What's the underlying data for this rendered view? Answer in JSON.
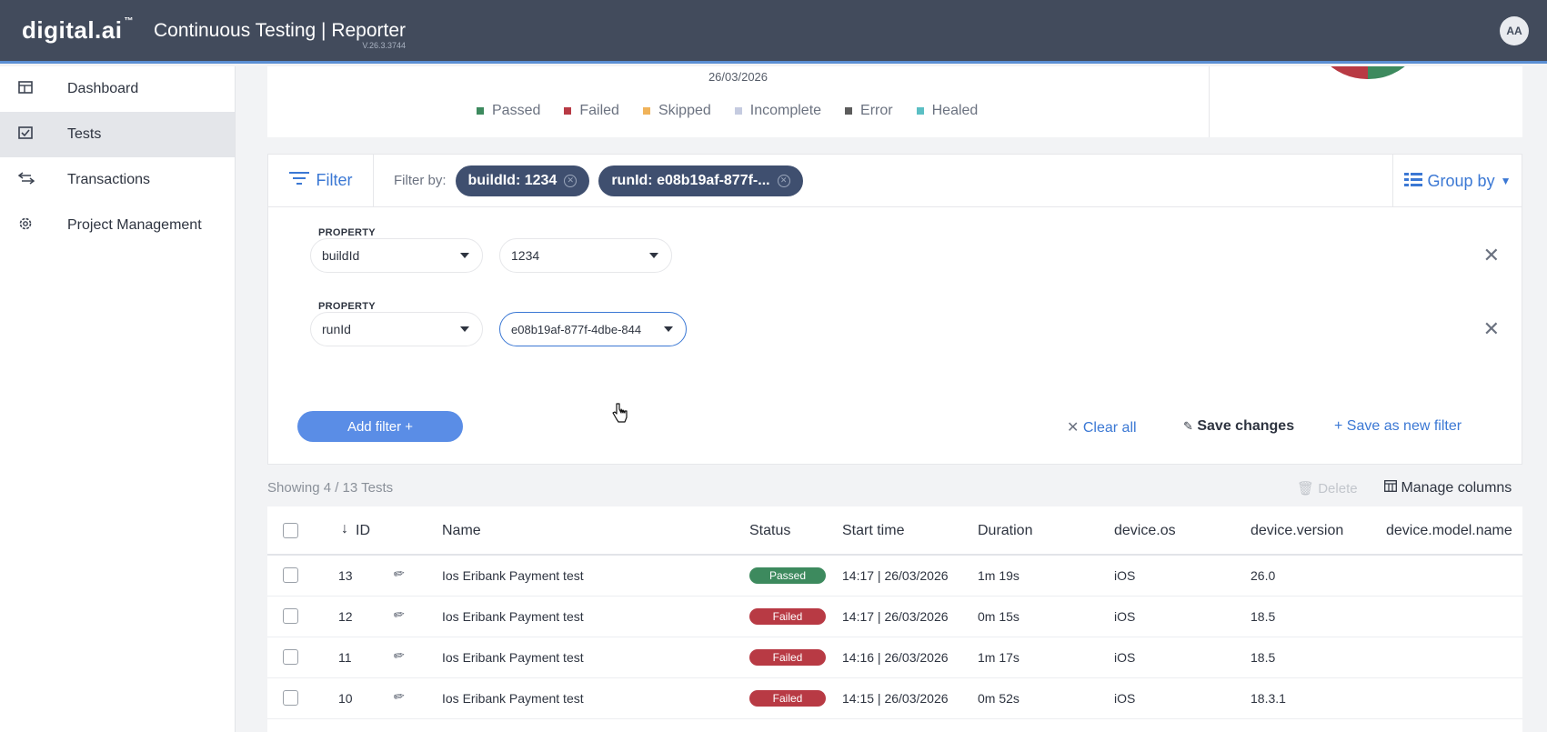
{
  "header": {
    "logo": "digital.ai",
    "app_title": "Continuous Testing | Reporter",
    "version": "V.26.3.3744",
    "avatar": "AA"
  },
  "sidebar": {
    "items": [
      {
        "label": "Dashboard",
        "icon": "dashboard-icon",
        "active": false
      },
      {
        "label": "Tests",
        "icon": "tests-icon",
        "active": true
      },
      {
        "label": "Transactions",
        "icon": "transactions-icon",
        "active": false
      },
      {
        "label": "Project Management",
        "icon": "gear-icon",
        "active": false
      }
    ]
  },
  "chart": {
    "date": "26/03/2026",
    "legend": [
      {
        "label": "Passed",
        "color": "#3d8a5e"
      },
      {
        "label": "Failed",
        "color": "#b83a44"
      },
      {
        "label": "Skipped",
        "color": "#f0b35a"
      },
      {
        "label": "Incomplete",
        "color": "#c5cbe0"
      },
      {
        "label": "Error",
        "color": "#5c5c5c"
      },
      {
        "label": "Healed",
        "color": "#5bbfc4"
      }
    ]
  },
  "filter": {
    "filter_label": "Filter",
    "filter_by_label": "Filter by:",
    "chips": [
      "buildId: 1234",
      "runId: e08b19af-877f-..."
    ],
    "group_by_label": "Group by",
    "property_label": "PROPERTY",
    "rules": [
      {
        "property": "buildId",
        "value": "1234"
      },
      {
        "property": "runId",
        "value": "e08b19af-877f-4dbe-844"
      }
    ],
    "add_filter_label": "Add filter +",
    "clear_all_label": "Clear all",
    "save_changes_label": "Save changes",
    "save_new_label": "Save as new filter"
  },
  "tests": {
    "showing": "Showing 4 / 13 Tests",
    "delete_label": "Delete",
    "manage_columns_label": "Manage columns",
    "columns": [
      "ID",
      "Name",
      "Status",
      "Start time",
      "Duration",
      "device.os",
      "device.version",
      "device.model.name"
    ],
    "rows": [
      {
        "id": "13",
        "name": "Ios Eribank Payment test",
        "status": "Passed",
        "start": "14:17 | 26/03/2026",
        "duration": "1m 19s",
        "os": "iOS",
        "version": "26.0",
        "model": ""
      },
      {
        "id": "12",
        "name": "Ios Eribank Payment test",
        "status": "Failed",
        "start": "14:17 | 26/03/2026",
        "duration": "0m 15s",
        "os": "iOS",
        "version": "18.5",
        "model": ""
      },
      {
        "id": "11",
        "name": "Ios Eribank Payment test",
        "status": "Failed",
        "start": "14:16 | 26/03/2026",
        "duration": "1m 17s",
        "os": "iOS",
        "version": "18.5",
        "model": ""
      },
      {
        "id": "10",
        "name": "Ios Eribank Payment test",
        "status": "Failed",
        "start": "14:15 | 26/03/2026",
        "duration": "0m 52s",
        "os": "iOS",
        "version": "18.3.1",
        "model": ""
      }
    ],
    "status_colors": {
      "Passed": "#3d8a5e",
      "Failed": "#b83a44"
    }
  }
}
